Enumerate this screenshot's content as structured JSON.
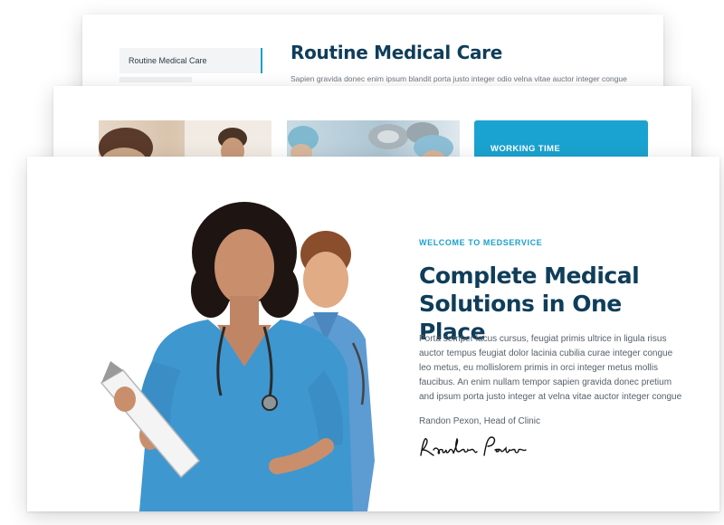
{
  "back_page": {
    "menu_items": [
      "Routine Medical Care"
    ],
    "title": "Routine Medical Care",
    "text": "Sapien gravida donec enim ipsum blandit porta justo integer odio velna vitae auctor integer congue"
  },
  "middle_page": {
    "working_time_label": "WORKING TIME"
  },
  "front_page": {
    "eyebrow": "WELCOME TO MEDSERVICE",
    "title": "Complete Medical Solutions in One Place",
    "text": "Porta semper lacus cursus, feugiat primis ultrice in ligula risus auctor tempus feugiat dolor lacinia cubilia curae integer congue leo metus, eu mollislorem primis in orci integer metus mollis faucibus. An enim nullam tempor sapien gravida donec pretium and ipsum porta justo integer at velna vitae auctor integer congue",
    "byline": "Randon Pexon, Head of Clinic",
    "signature": "Randon Pexon"
  },
  "colors": {
    "accent": "#1aa3d1",
    "heading": "#0f3d5a",
    "body_text": "#55606b"
  }
}
